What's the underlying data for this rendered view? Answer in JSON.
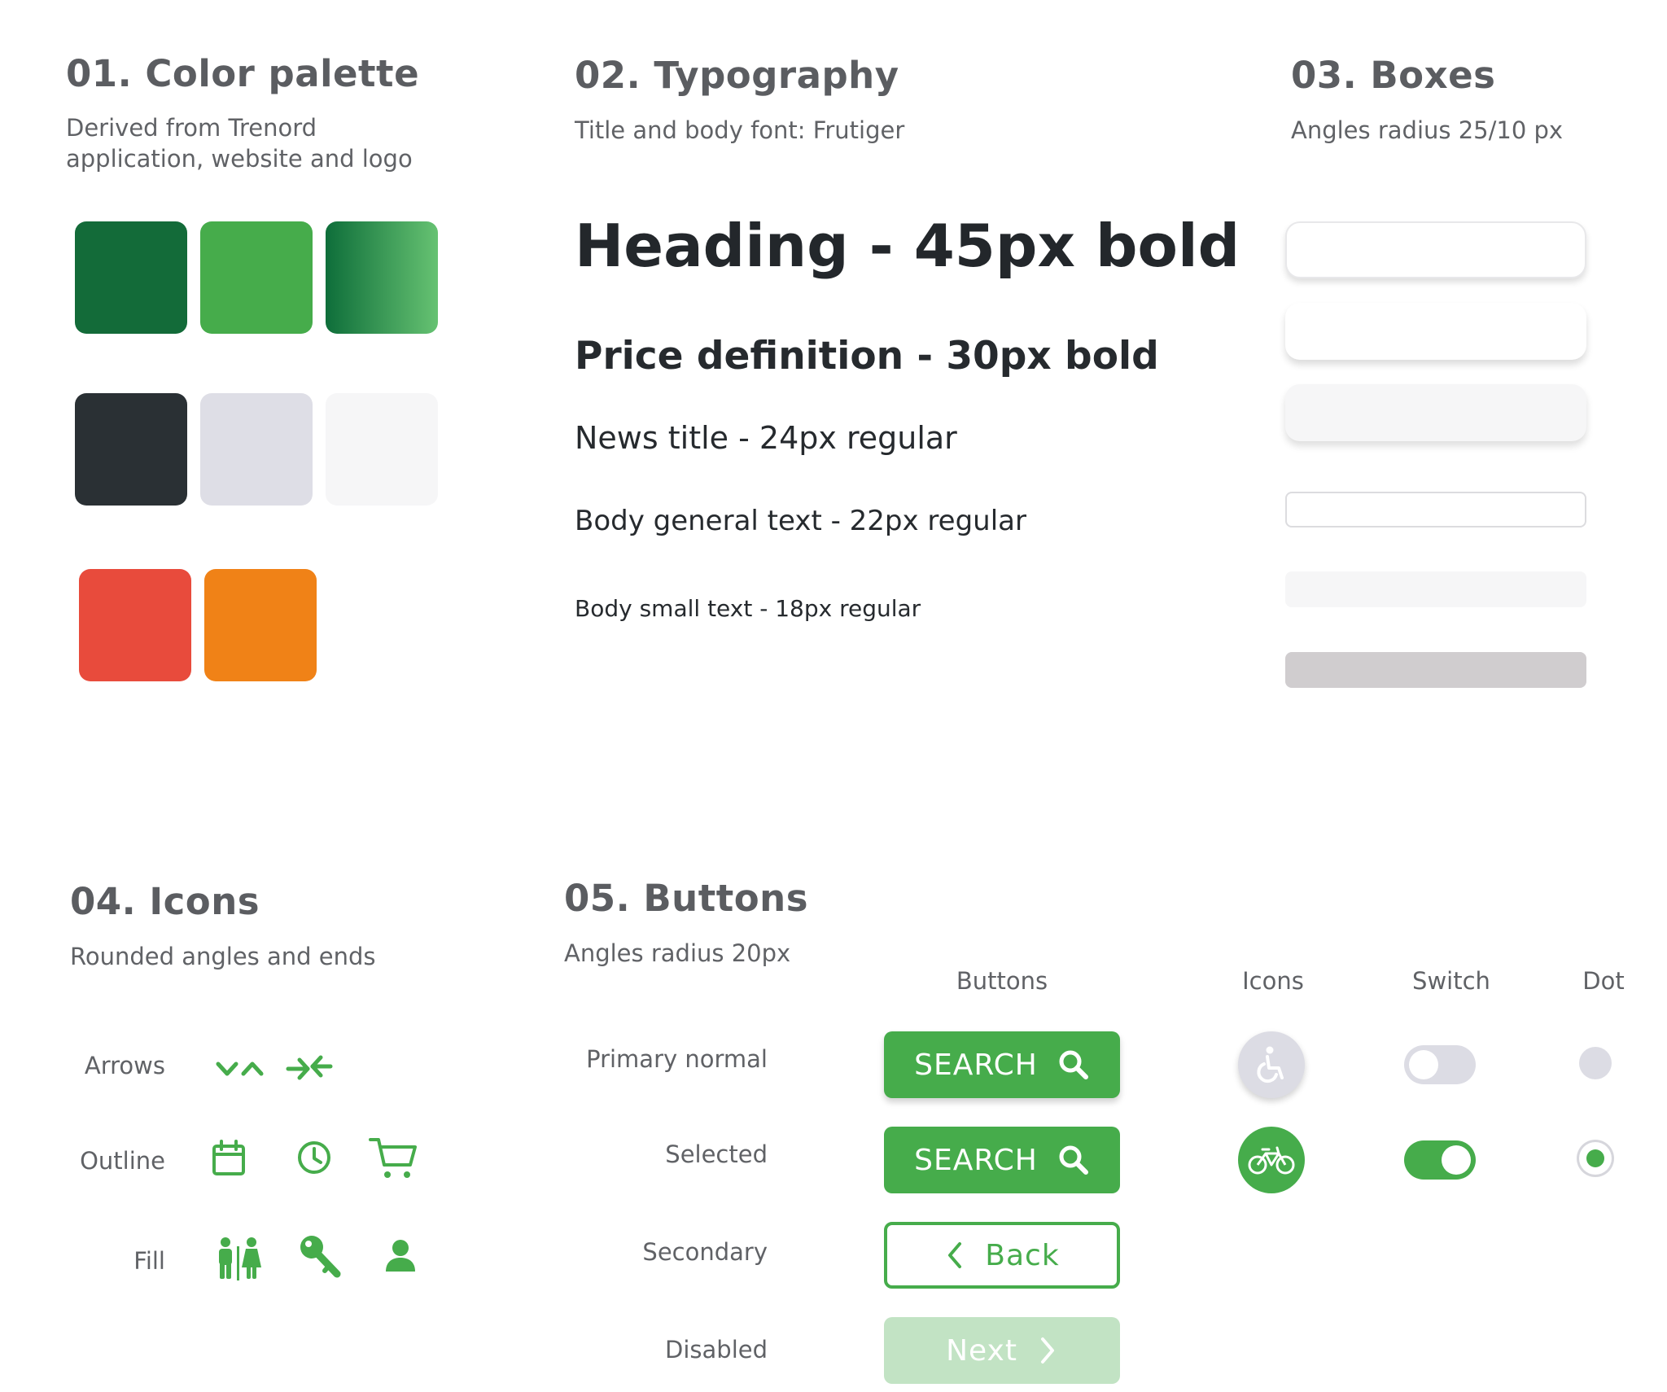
{
  "palette": {
    "title": "01. Color palette",
    "subtitle_line1": "Derived from Trenord",
    "subtitle_line2": "application, website and logo",
    "colors": {
      "dark_green": "#136b39",
      "green": "#46ac4b",
      "gradient_start": "#0e6e3a",
      "gradient_end": "#66c272",
      "charcoal": "#2a3034",
      "light_gray": "#dedee6",
      "off_white": "#f6f6f7",
      "red": "#e84b3c",
      "orange": "#f08217"
    }
  },
  "typography": {
    "title": "02. Typography",
    "subtitle": "Title and body font: Frutiger",
    "heading": "Heading - 45px bold",
    "price": "Price definition - 30px bold",
    "news": "News title - 24px regular",
    "body_general": "Body  general text - 22px regular",
    "body_small": "Body  small text - 18px regular"
  },
  "boxes": {
    "title": "03. Boxes",
    "subtitle": "Angles radius 25/10 px"
  },
  "icons": {
    "title": "04. Icons",
    "subtitle": "Rounded angles and ends",
    "rows": {
      "arrows": "Arrows",
      "outline": "Outline",
      "fill": "Fill"
    }
  },
  "buttons": {
    "title": "05. Buttons",
    "subtitle": "Angles radius 20px",
    "columns": {
      "buttons": "Buttons",
      "icons": "Icons",
      "switch": "Switch",
      "dot": "Dot"
    },
    "rows": {
      "primary": "Primary normal",
      "selected": "Selected",
      "secondary": "Secondary",
      "disabled": "Disabled"
    },
    "labels": {
      "search": "SEARCH",
      "back": "Back",
      "next": "Next"
    }
  }
}
